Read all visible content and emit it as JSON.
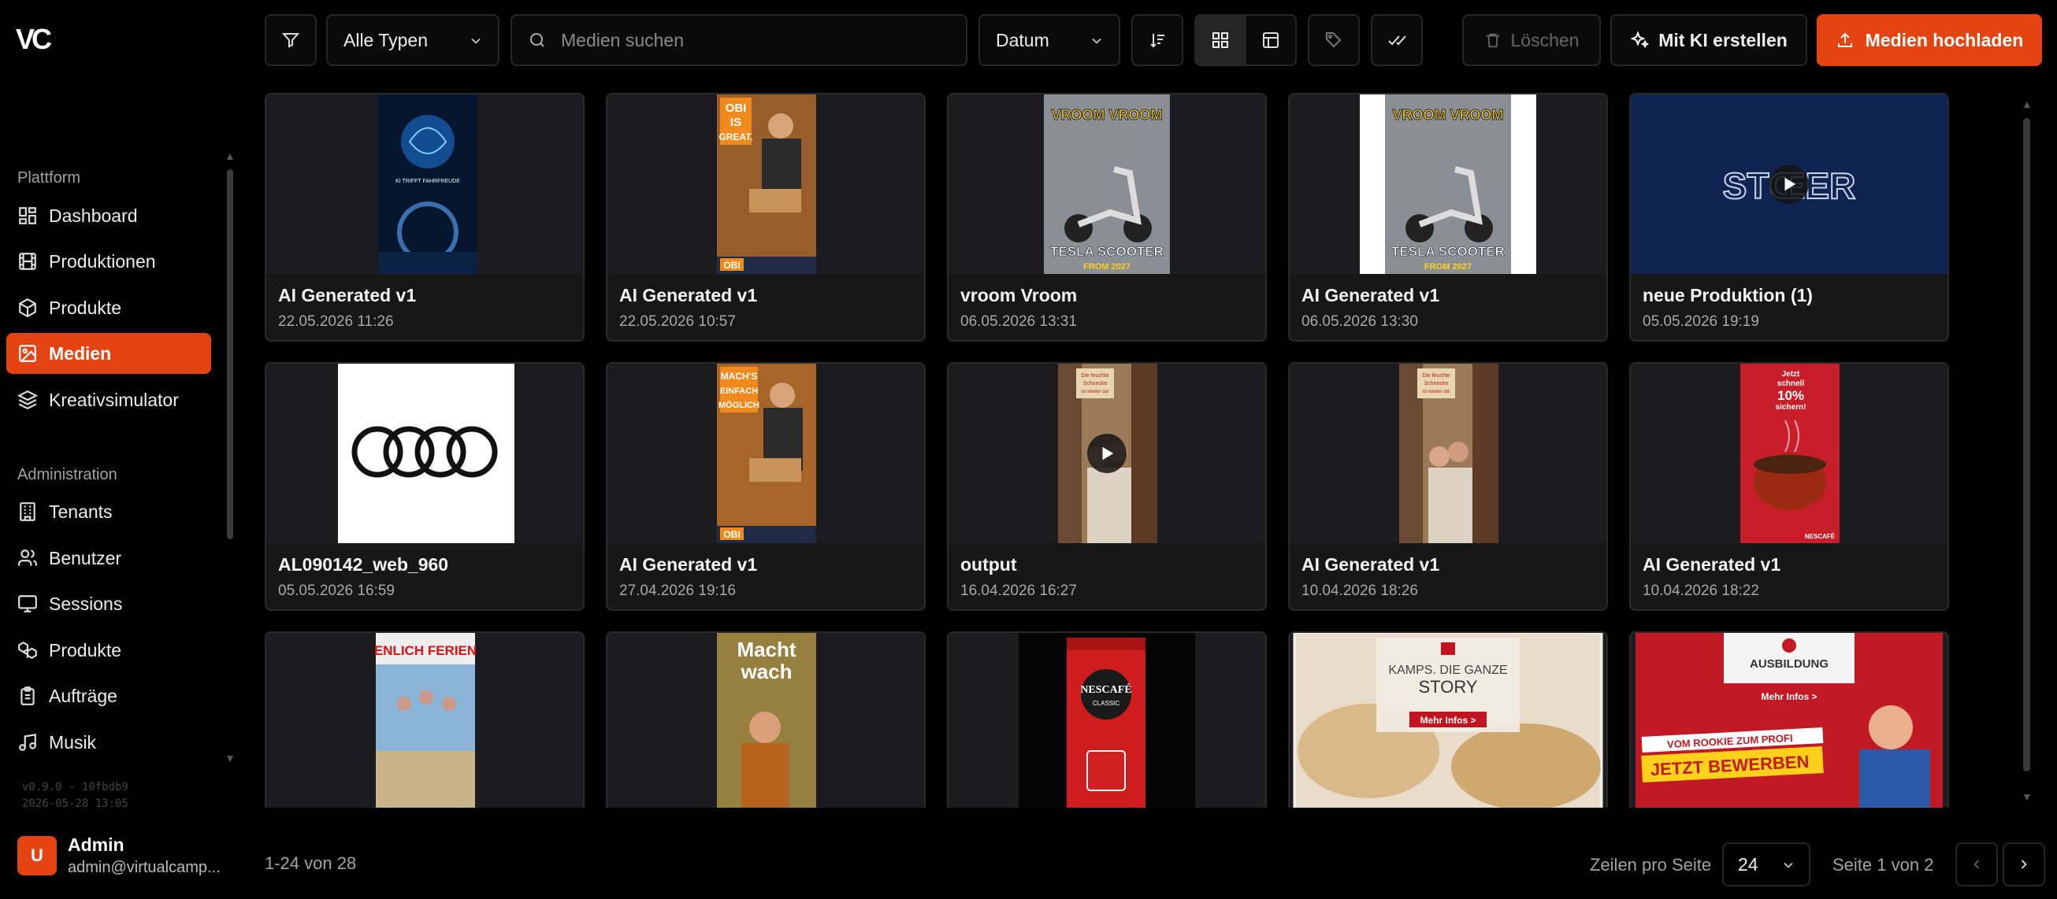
{
  "app": {
    "logo_text": "VC"
  },
  "sidebar": {
    "section_platform": "Plattform",
    "platform_items": [
      {
        "label": "Dashboard",
        "icon": "dashboard-icon"
      },
      {
        "label": "Produktionen",
        "icon": "film-icon"
      },
      {
        "label": "Produkte",
        "icon": "box-icon"
      },
      {
        "label": "Medien",
        "icon": "image-icon",
        "active": true
      },
      {
        "label": "Kreativsimulator",
        "icon": "layers-icon"
      }
    ],
    "section_admin": "Administration",
    "admin_items": [
      {
        "label": "Tenants",
        "icon": "building-icon"
      },
      {
        "label": "Benutzer",
        "icon": "users-icon"
      },
      {
        "label": "Sessions",
        "icon": "monitor-icon"
      },
      {
        "label": "Produkte",
        "icon": "boxes-icon"
      },
      {
        "label": "Aufträge",
        "icon": "clipboard-icon"
      },
      {
        "label": "Musik",
        "icon": "music-icon"
      }
    ],
    "version_line1": "v0.9.0 - 10fbdb9",
    "version_line2": "2026-05-28 13:05",
    "user": {
      "initial": "U",
      "name": "Admin",
      "email": "admin@virtualcamp..."
    }
  },
  "toolbar": {
    "type_filter": "Alle Typen",
    "search_placeholder": "Medien suchen",
    "sort_field": "Datum",
    "delete_label": "Löschen",
    "ai_label": "Mit KI erstellen",
    "upload_label": "Medien hochladen"
  },
  "media": [
    {
      "title": "AI Generated v1",
      "date": "22.05.2026 11:26",
      "thumb": "car-interior",
      "video": false
    },
    {
      "title": "AI Generated v1",
      "date": "22.05.2026 10:57",
      "thumb": "obi-great",
      "video": false
    },
    {
      "title": "vroom Vroom",
      "date": "06.05.2026 13:31",
      "thumb": "scooter",
      "video": false
    },
    {
      "title": "AI Generated v1",
      "date": "06.05.2026 13:30",
      "thumb": "scooter",
      "video": false
    },
    {
      "title": "neue Produktion (1)",
      "date": "05.05.2026 19:19",
      "thumb": "stoer",
      "video": true
    },
    {
      "title": "AL090142_web_960",
      "date": "05.05.2026 16:59",
      "thumb": "audi",
      "video": false
    },
    {
      "title": "AI Generated v1",
      "date": "27.04.2026 19:16",
      "thumb": "obi-machs",
      "video": false
    },
    {
      "title": "output",
      "date": "16.04.2026 16:27",
      "thumb": "couple",
      "video": true
    },
    {
      "title": "AI Generated v1",
      "date": "10.04.2026 18:26",
      "thumb": "couple",
      "video": false
    },
    {
      "title": "AI Generated v1",
      "date": "10.04.2026 18:22",
      "thumb": "coffee",
      "video": false
    },
    {
      "title": "",
      "date": "",
      "thumb": "ferien",
      "video": false
    },
    {
      "title": "",
      "date": "",
      "thumb": "macht-wach",
      "video": false
    },
    {
      "title": "",
      "date": "",
      "thumb": "nescafe",
      "video": false
    },
    {
      "title": "",
      "date": "",
      "thumb": "kamps",
      "video": false
    },
    {
      "title": "",
      "date": "",
      "thumb": "ausbildung",
      "video": false
    }
  ],
  "thumb_text": {
    "car": "KI TRIFFT FAHRFREUDE",
    "obi_great": [
      "OBI",
      "IS",
      "GREAT."
    ],
    "obi_brand": "OBI",
    "vroom": "VROOM VROOM",
    "tesla": [
      "TESLA SCOOTER",
      "FROM 2027"
    ],
    "stoer": "STŒER",
    "obi_machs": [
      "MACH'S",
      "EINFACH",
      "MÖGLICH"
    ],
    "couple_sign": [
      "Die feuchte",
      "Schnecke",
      "ist wieder da!"
    ],
    "coffee": [
      "Jetzt",
      "schnell",
      "10%",
      "sichern!"
    ],
    "coffee_brand": "NESCAFÉ",
    "ferien": "ENLICH FERIEN",
    "macht_wach": [
      "Macht",
      "wach"
    ],
    "nescafe": [
      "NESCAFÉ",
      "CLASSIC"
    ],
    "kamps": [
      "KAMPS. DIE GANZE",
      "STORY",
      "Mehr Infos >"
    ],
    "ausbildung": [
      "AUSBILDUNG",
      "Mehr Infos >",
      "VOM ROOKIE ZUM PROFI",
      "JETZT BEWERBEN"
    ]
  },
  "footer": {
    "range": "1-24 von 28",
    "rows_label": "Zeilen pro Seite",
    "rows_value": "24",
    "page_info": "Seite 1 von 2"
  },
  "colors": {
    "accent": "#e44412",
    "background": "#000000",
    "card": "#171717",
    "border": "#2a2a2a"
  }
}
